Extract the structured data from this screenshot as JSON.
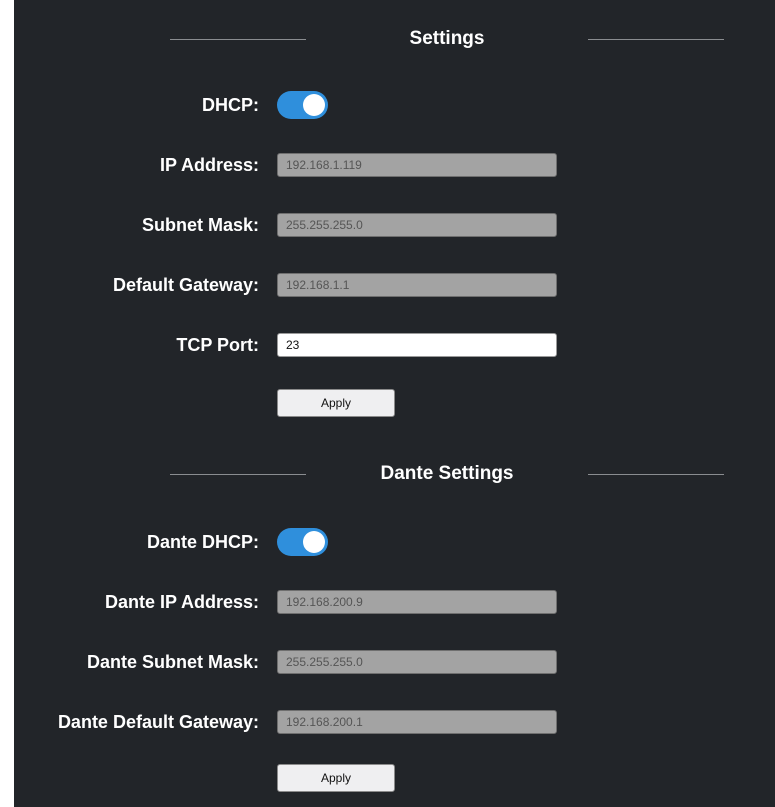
{
  "settings": {
    "title": "Settings",
    "dhcp": {
      "label": "DHCP:",
      "enabled": true
    },
    "ip_address": {
      "label": "IP Address:",
      "value": "192.168.1.119"
    },
    "subnet_mask": {
      "label": "Subnet Mask:",
      "value": "255.255.255.0"
    },
    "default_gateway": {
      "label": "Default Gateway:",
      "value": "192.168.1.1"
    },
    "tcp_port": {
      "label": "TCP Port:",
      "value": "23"
    },
    "apply_label": "Apply"
  },
  "dante": {
    "title": "Dante Settings",
    "dhcp": {
      "label": "Dante DHCP:",
      "enabled": true
    },
    "ip_address": {
      "label": "Dante IP Address:",
      "value": "192.168.200.9"
    },
    "subnet_mask": {
      "label": "Dante Subnet Mask:",
      "value": "255.255.255.0"
    },
    "default_gateway": {
      "label": "Dante Default Gateway:",
      "value": "192.168.200.1"
    },
    "apply_label": "Apply"
  },
  "colors": {
    "panel_background": "#222529",
    "toggle_on": "#2f8fdc",
    "disabled_field": "#a3a3a3"
  }
}
